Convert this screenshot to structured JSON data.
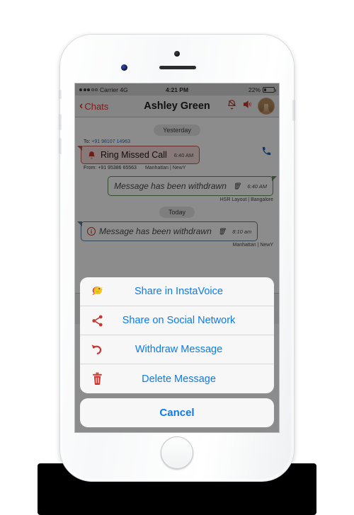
{
  "status_bar": {
    "carrier": "Carrier 4G",
    "signal_dots_filled": 3,
    "signal_dots_total": 5,
    "time": "4:21 PM",
    "battery_percent": "22%",
    "battery_level": 22
  },
  "nav_bar": {
    "back_label": "Chats",
    "title": "Ashley Green",
    "icons": [
      {
        "name": "bell-mute-icon",
        "color": "#c0392b"
      },
      {
        "name": "speaker-icon",
        "color": "#c0392b"
      },
      {
        "name": "contact-avatar",
        "color": "#c9a58a"
      }
    ]
  },
  "chat": {
    "day_separators": {
      "yesterday": "Yesterday",
      "today": "Today"
    },
    "messages": [
      {
        "type": "missed-call",
        "to_label": "To:",
        "to_number": "+91 98107 14963",
        "text": "Ring Missed Call",
        "time": "6:40 AM",
        "from_label": "From:",
        "from_number": "+91 95386 65563",
        "location": "Manhattan | NewY",
        "icon": "bell-icon",
        "call_back_icon": "phone-icon"
      },
      {
        "type": "withdrawn-outgoing",
        "text": "Message has been withdrawn",
        "time": "6:40 AM",
        "location": "HSR Layout | Bangalore",
        "icon": "trash-icon"
      },
      {
        "type": "withdrawn-incoming",
        "text": "Message has been withdrawn",
        "time": "8:10 am",
        "location": "Manhattan | NewY",
        "icon": "info-icon",
        "trash_icon": "trash-icon"
      }
    ]
  },
  "action_sheet": {
    "items": [
      {
        "label": "Share in InstaVoice",
        "icon": "parrot-icon"
      },
      {
        "label": "Share on Social Network",
        "icon": "share-icon"
      },
      {
        "label": "Withdraw Message",
        "icon": "undo-arrow-icon"
      },
      {
        "label": "Delete Message",
        "icon": "trash-icon"
      }
    ],
    "cancel_label": "Cancel"
  },
  "colors": {
    "accent_blue": "#0a7bf2",
    "accent_red": "#c0392b",
    "nav_red": "#e0382f",
    "outgoing_border": "#5f8f55",
    "incoming_border": "#5b7f9e",
    "missed_border": "#c75a52"
  }
}
